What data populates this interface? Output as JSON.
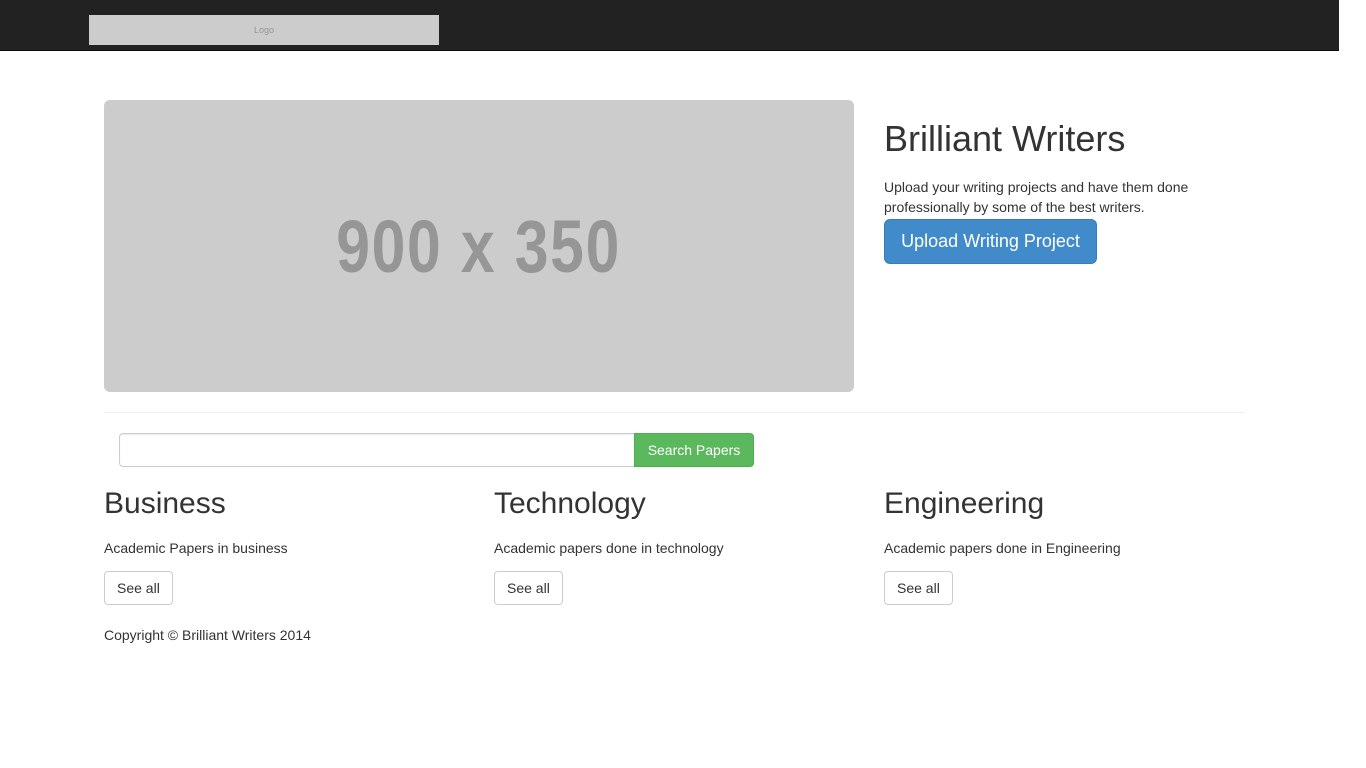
{
  "navbar": {
    "logo_text": "Logo"
  },
  "hero": {
    "image_placeholder": "900 x 350",
    "title": "Brilliant Writers",
    "description": "Upload your writing projects and have them done professionally by some of the best writers.",
    "cta_label": "Upload Writing Project"
  },
  "search": {
    "value": "",
    "placeholder": "",
    "button_label": "Search Papers"
  },
  "categories": [
    {
      "title": "Business",
      "description": "Academic Papers in business",
      "button_label": "See all"
    },
    {
      "title": "Technology",
      "description": "Academic papers done in technology",
      "button_label": "See all"
    },
    {
      "title": "Engineering",
      "description": "Academic papers done in Engineering",
      "button_label": "See all"
    }
  ],
  "footer": {
    "copyright": "Copyright © Brilliant Writers 2014"
  },
  "colors": {
    "navbar_bg": "#222222",
    "primary": "#428bca",
    "success": "#5cb85c",
    "placeholder_bg": "#cccccc"
  }
}
